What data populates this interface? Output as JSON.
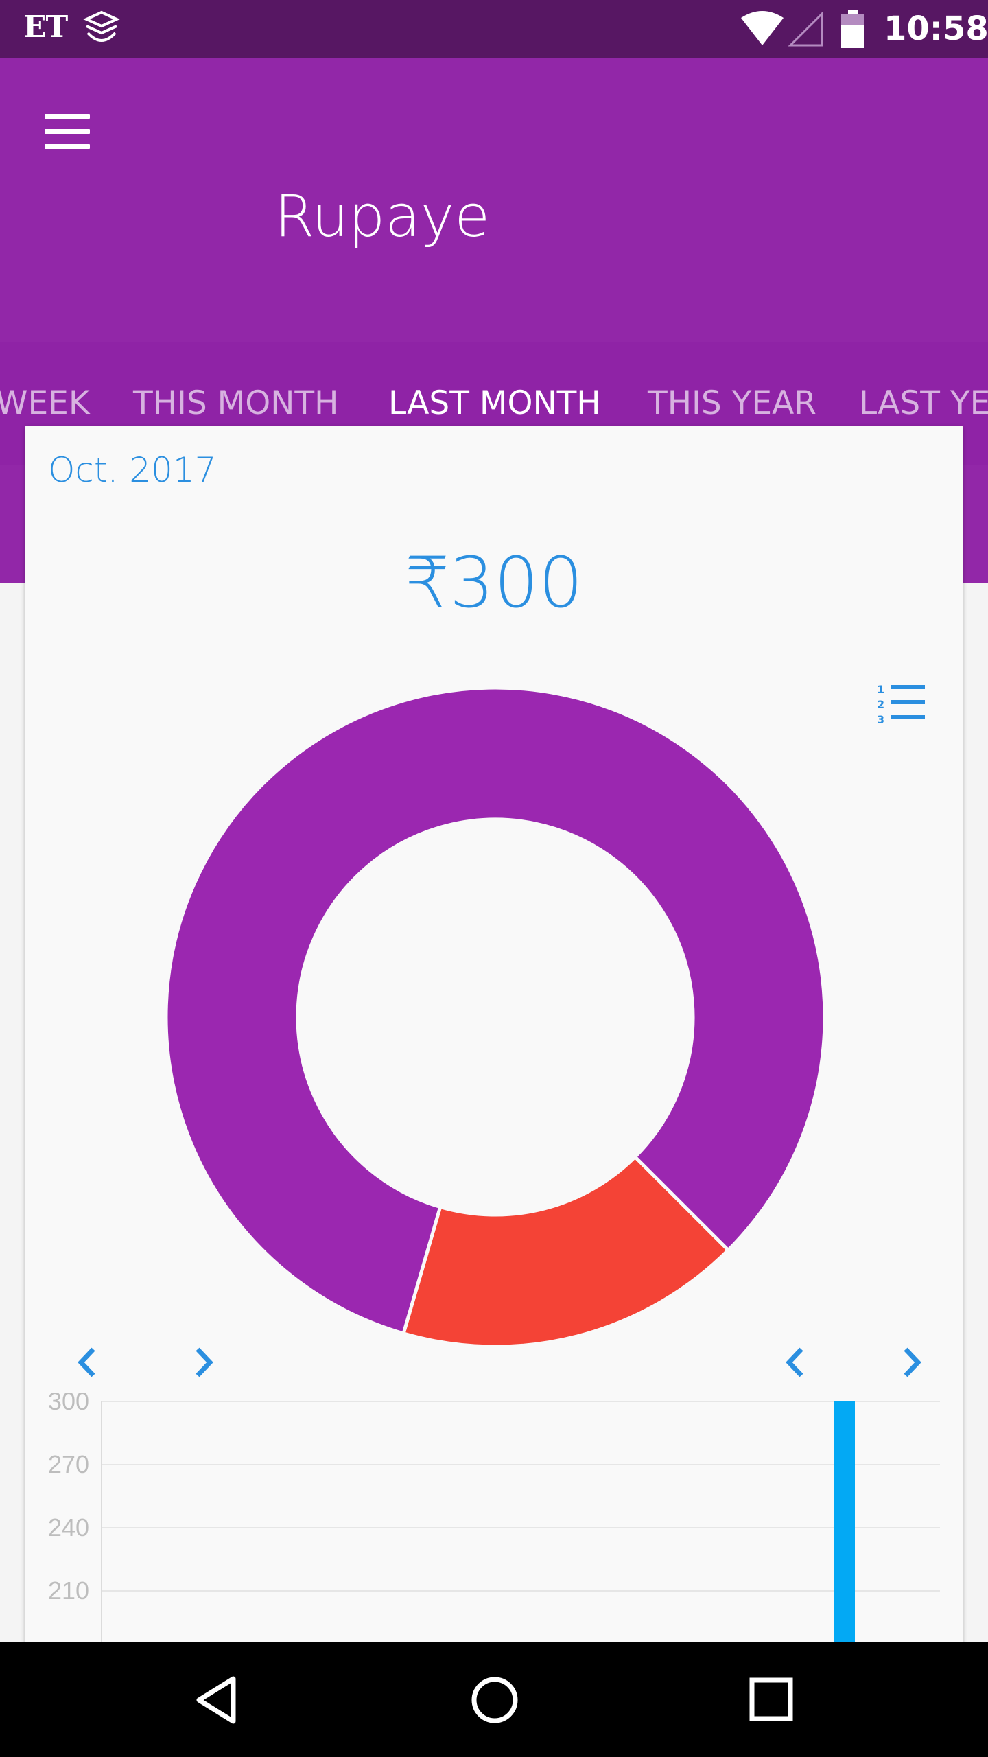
{
  "status_bar": {
    "carrier_label": "ET",
    "time": "10:58",
    "icons": [
      "app-notification-icon",
      "wifi-icon",
      "signal-icon",
      "battery-icon"
    ]
  },
  "app_bar": {
    "title": "Rupaye",
    "menu_icon": "hamburger-menu-icon",
    "color": "#9227a8"
  },
  "tabs": [
    {
      "label": "WEEK",
      "active": false
    },
    {
      "label": "THIS MONTH",
      "active": false
    },
    {
      "label": "LAST MONTH",
      "active": true
    },
    {
      "label": "THIS YEAR",
      "active": false
    },
    {
      "label": "LAST YEA",
      "active": false
    }
  ],
  "card": {
    "period": "Oct. 2017",
    "total": "₹300",
    "list_toggle_icon": "numbered-list-icon",
    "accent": "#2b8fe0"
  },
  "chart_data": [
    {
      "type": "pie",
      "style": "donut",
      "slices": [
        {
          "value": 83,
          "color": "#9b27b0"
        },
        {
          "value": 17,
          "color": "#f44336"
        }
      ]
    },
    {
      "type": "bar",
      "y_ticks": [
        "300",
        "270",
        "240",
        "210"
      ],
      "ylim": [
        210,
        300
      ],
      "values": [
        300
      ],
      "bar_color": "#03a9f4",
      "grid": true
    }
  ],
  "navigation": {
    "back_icon": "back-triangle-icon",
    "home_icon": "home-circle-icon",
    "recents_icon": "recents-square-icon"
  }
}
